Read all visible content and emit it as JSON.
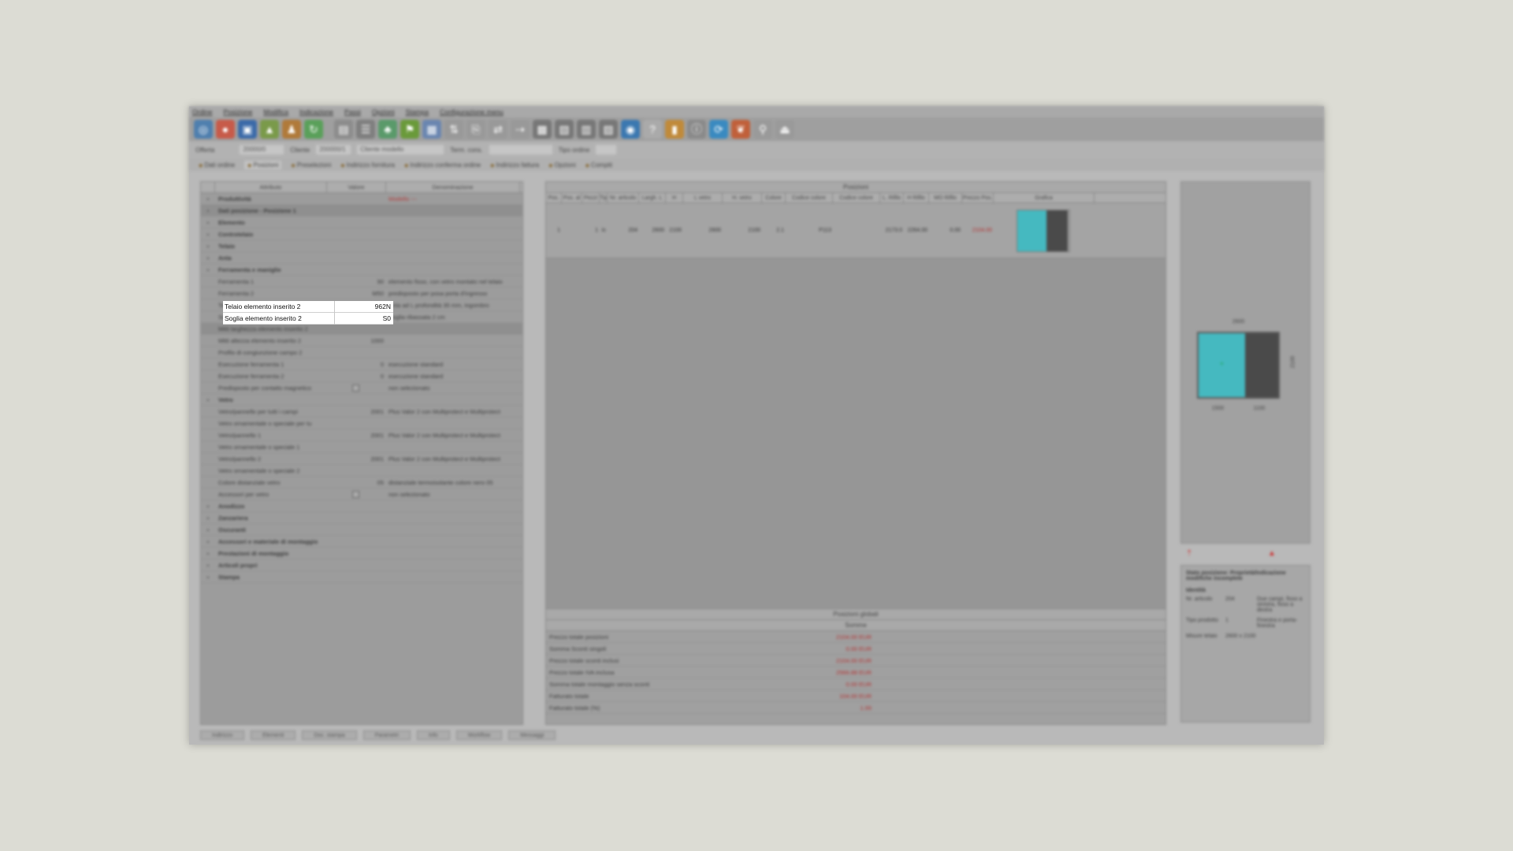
{
  "menu": [
    "Ordine",
    "Posizione",
    "Modifica",
    "Indicazione",
    "Passi",
    "Opzioni",
    "Stampa",
    "Configurazione menu"
  ],
  "order_bar": {
    "offer_label": "Offerta",
    "offer_value": "20000/0",
    "client_label": "Cliente",
    "client_value": "200000/1",
    "client_name": "Cliente modello",
    "term_label": "Term. cons.",
    "type_label": "Tipo ordine"
  },
  "tabs": [
    "Dati ordine",
    "Posizioni",
    "Preselezioni",
    "Indirizzo fornitura",
    "Indirizzo conferma ordine",
    "Indirizzo fattura",
    "Opzioni",
    "Compiti"
  ],
  "attr_table": {
    "headers": [
      "Attributo",
      "Valore",
      "Denominazione"
    ],
    "rows": [
      {
        "name": "Produttività",
        "value": "",
        "desc": "Modello ---",
        "group": true
      },
      {
        "name": "Dati posizione - Posizione 1",
        "value": "",
        "desc": "",
        "group": true
      },
      {
        "name": "Elemento",
        "value": "",
        "desc": "",
        "group": true
      },
      {
        "name": "Controtelaio",
        "value": "",
        "desc": "",
        "group": true
      },
      {
        "name": "Telaio",
        "value": "",
        "desc": "",
        "group": true
      },
      {
        "name": "Anta",
        "value": "",
        "desc": "",
        "group": true
      },
      {
        "name": "Ferramenta e maniglie",
        "value": "",
        "desc": "",
        "group": true
      },
      {
        "name": "Ferramenta 1",
        "value": "90",
        "desc": "elemento fisso, con vetro montato nel telaio"
      },
      {
        "name": "Ferramenta 2",
        "value": "M50",
        "desc": "predisposto per posa porta d'ingresso"
      },
      {
        "name": "Telaio elemento inserito 2",
        "value": "962N",
        "desc": "Anta ad L profondità 35 mm, ingombro"
      },
      {
        "name": "Soglia elemento inserito 2",
        "value": "S0",
        "desc": "Soglia ribassata 2 cm"
      },
      {
        "name": "Mitti larghezza elemento inserito 2",
        "value": "",
        "desc": ""
      },
      {
        "name": "Mitti altezza elemento inserito 2",
        "value": "1000",
        "desc": ""
      },
      {
        "name": "Profilo di congiunzione campo 2",
        "value": "",
        "desc": ""
      },
      {
        "name": "Esecuzione ferramenta 1",
        "value": "0",
        "desc": "esecuzione standard"
      },
      {
        "name": "Esecuzione ferramenta 2",
        "value": "0",
        "desc": "esecuzione standard"
      },
      {
        "name": "Predisposto per contatto magnetico",
        "value": "",
        "desc": "non selezionato",
        "check": true
      },
      {
        "name": "Vetro",
        "value": "",
        "desc": "",
        "group": true
      },
      {
        "name": "Vetro/pannello per tutti i campi",
        "value": "2001",
        "desc": "Plus Valor 2 con Multiprotect e Multiprotect"
      },
      {
        "name": "Vetro ornamentale o speciale per tu",
        "value": "",
        "desc": ""
      },
      {
        "name": "Vetro/pannello 1",
        "value": "2001",
        "desc": "Plus Valor 2 con Multiprotect e Multiprotect"
      },
      {
        "name": "Vetro ornamentale o speciale 1",
        "value": "",
        "desc": ""
      },
      {
        "name": "Vetro/pannello 2",
        "value": "2001",
        "desc": "Plus Valor 2 con Multiprotect e Multiprotect"
      },
      {
        "name": "Vetro ornamentale o speciale 2",
        "value": "",
        "desc": ""
      },
      {
        "name": "Colore distanziale vetro",
        "value": "05",
        "desc": "distanziale termoisolante colore nero 05"
      },
      {
        "name": "Accessori per vetro",
        "value": "",
        "desc": "non selezionato",
        "check": true
      },
      {
        "name": "Anodizzo",
        "value": "",
        "desc": "",
        "group": true
      },
      {
        "name": "Zanzariera",
        "value": "",
        "desc": "",
        "group": true
      },
      {
        "name": "Oscuranti",
        "value": "",
        "desc": "",
        "group": true
      },
      {
        "name": "Accessori e materiale di montaggio",
        "value": "",
        "desc": "",
        "group": true
      },
      {
        "name": "Prestazioni di montaggio",
        "value": "",
        "desc": "",
        "group": true
      },
      {
        "name": "Articoli propri",
        "value": "",
        "desc": "",
        "group": true
      },
      {
        "name": "Stampa",
        "value": "",
        "desc": "",
        "group": true
      }
    ]
  },
  "highlight": [
    {
      "name": "Telaio elemento inserito 2",
      "value": "962N"
    },
    {
      "name": "Soglia elemento inserito 2",
      "value": "S0"
    }
  ],
  "positions": {
    "title": "Posizioni",
    "headers": [
      "Pos.",
      "Pos. al",
      "Pezzi",
      "Tipo",
      "Nr. articolo",
      "Largh. L",
      "H",
      "L vetro",
      "H. vetro",
      "Colore",
      "Codice colore",
      "Codice colore",
      "L. Rifilo",
      "H Rifilo",
      "MO Rifilo",
      "Prezzo Pos.",
      "Grafica"
    ],
    "row": [
      "1",
      "",
      "1",
      "Ic",
      "204",
      "2600",
      "2100",
      "2600",
      "2100",
      "2.1",
      "P113",
      "",
      "2173.0",
      "2264.00",
      "0.00",
      "2104.00",
      ""
    ]
  },
  "totals": {
    "title": "Posizioni globali",
    "sum_title": "Somme",
    "rows": [
      {
        "label": "Prezzo totale posizioni",
        "value": "2104.00 EUR"
      },
      {
        "label": "Somma Sconti singoli",
        "value": "0.00 EUR"
      },
      {
        "label": "Prezzo totale sconti inclusi",
        "value": "2104.00 EUR"
      },
      {
        "label": "Prezzo totale IVA inclusa",
        "value": "2566.88 EUR"
      },
      {
        "label": "Somma totale montaggio senza sconti",
        "value": "0.00 EUR"
      },
      {
        "label": "Fatturato totale",
        "value": "104.00 EUR"
      },
      {
        "label": "Fatturato totale (%)",
        "value": "1.00"
      }
    ]
  },
  "info_panel": {
    "title": "Stato posizione: Proprietà/Indicazione modifiche incomplete",
    "section": "Identità",
    "rows": [
      {
        "k": "Nr. articolo",
        "v": "204",
        "d": "Due campi, fisso a sinistra, fisso a destra"
      },
      {
        "k": "Tipo prodotto",
        "v": "1",
        "d": "Finestra e porta-finestra"
      },
      {
        "k": "Misure telaio",
        "v": "2600 x 2100",
        "d": ""
      }
    ]
  },
  "preview_dims": {
    "width": "2600",
    "left": "1500",
    "right": "1100",
    "height": "2100"
  },
  "status_tabs": [
    "Indirizzo",
    "Elementi",
    "Doc. stampa",
    "Parametri",
    "Info",
    "Workflow",
    "Messaggi"
  ]
}
